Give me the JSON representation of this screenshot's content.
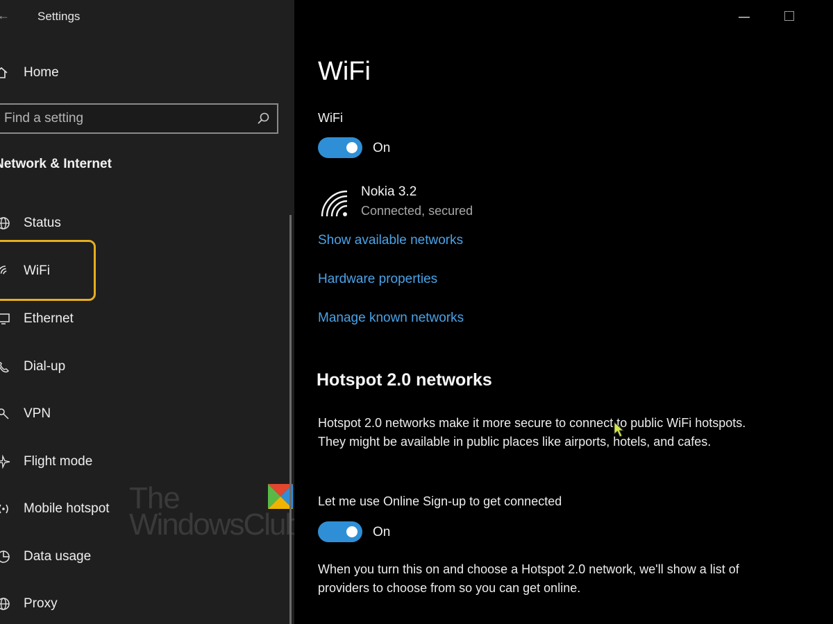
{
  "sidebar": {
    "app_title": "Settings",
    "home_label": "Home",
    "search_placeholder": "Find a setting",
    "section_title": "Network & Internet",
    "items": [
      {
        "label": "Status",
        "icon": "globe-icon"
      },
      {
        "label": "WiFi",
        "icon": "wifi-icon",
        "selected": true
      },
      {
        "label": "Ethernet",
        "icon": "monitor-icon"
      },
      {
        "label": "Dial-up",
        "icon": "phone-icon"
      },
      {
        "label": "VPN",
        "icon": "vpn-icon"
      },
      {
        "label": "Flight mode",
        "icon": "airplane-icon"
      },
      {
        "label": "Mobile hotspot",
        "icon": "hotspot-icon"
      },
      {
        "label": "Data usage",
        "icon": "data-usage-icon"
      },
      {
        "label": "Proxy",
        "icon": "globe-icon"
      }
    ],
    "watermark": {
      "line1": "The",
      "line2": "WindowsClub"
    }
  },
  "main": {
    "title": "WiFi",
    "wifi_label": "WiFi",
    "wifi_toggle_state": "On",
    "network": {
      "name": "Nokia 3.2",
      "status": "Connected, secured"
    },
    "links": {
      "show_available": "Show available networks",
      "hardware": "Hardware properties",
      "manage_known": "Manage known networks"
    },
    "hotspot": {
      "heading": "Hotspot 2.0 networks",
      "description": "Hotspot 2.0 networks make it more secure to connect to public WiFi hotspots. They might be available in public places like airports, hotels, and cafes.",
      "online_signup_label": "Let me use Online Sign-up to get connected",
      "online_signup_state": "On",
      "footer": "When you turn this on and choose a Hotspot 2.0 network, we'll show a list of providers to choose from so you can get online."
    }
  },
  "colors": {
    "accent": "#2f8fd6",
    "link": "#4aa3e8",
    "highlight": "#e6ae1f",
    "sidebar_bg": "#1f1f1f",
    "main_bg": "#000000"
  }
}
